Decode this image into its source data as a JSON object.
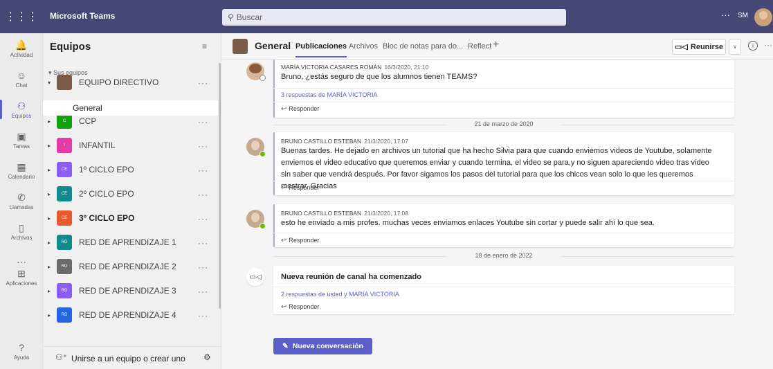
{
  "titlebar": {
    "app_name": "Microsoft Teams",
    "search_placeholder": "Buscar",
    "more": "···",
    "user_initials": "SM"
  },
  "rail": {
    "items": [
      {
        "label": "Actividad",
        "icon": "bell-icon",
        "glyph": "🔔"
      },
      {
        "label": "Chat",
        "icon": "chat-icon",
        "glyph": "☺"
      },
      {
        "label": "Equipos",
        "icon": "teams-icon",
        "glyph": "⚇"
      },
      {
        "label": "Tareas",
        "icon": "assignments-icon",
        "glyph": "▣"
      },
      {
        "label": "Calendario",
        "icon": "calendar-icon",
        "glyph": "▦"
      },
      {
        "label": "Llamadas",
        "icon": "phone-icon",
        "glyph": "✆"
      },
      {
        "label": "Archivos",
        "icon": "file-icon",
        "glyph": "▯"
      },
      {
        "label": "",
        "icon": "more-apps-icon",
        "glyph": "···"
      },
      {
        "label": "Aplicaciones",
        "icon": "apps-icon",
        "glyph": "⊞"
      },
      {
        "label": "Ayuda",
        "icon": "help-icon",
        "glyph": "?"
      }
    ],
    "active_index": 2
  },
  "teams_panel": {
    "title": "Equipos",
    "section_label": "Sus equipos",
    "selected_channel": "General",
    "teams": [
      {
        "name": "EQUIPO DIRECTIVO",
        "tile": "",
        "color": "#7a5c48",
        "bold": false,
        "expanded": true
      },
      {
        "name": "CCP",
        "tile": "C",
        "color": "#13a10e",
        "bold": false
      },
      {
        "name": "INFANTIL",
        "tile": "I",
        "color": "#e43ba6",
        "bold": false
      },
      {
        "name": "1º CICLO EPO",
        "tile": "CE",
        "color": "#8b5cf6",
        "bold": false
      },
      {
        "name": "2º CICLO EPO",
        "tile": "CE",
        "color": "#0f8b8d",
        "bold": false
      },
      {
        "name": "3º CICLO EPO",
        "tile": "CE",
        "color": "#e8592b",
        "bold": true
      },
      {
        "name": "RED DE APRENDIZAJE 1",
        "tile": "RD",
        "color": "#0f8b8d",
        "bold": false
      },
      {
        "name": "RED DE APRENDIZAJE 2",
        "tile": "RD",
        "color": "#6b6b6b",
        "bold": false
      },
      {
        "name": "RED DE APRENDIZAJE 3",
        "tile": "RD",
        "color": "#8b5cf6",
        "bold": false
      },
      {
        "name": "RED DE APRENDIZAJE 4",
        "tile": "RD",
        "color": "#2266e3",
        "bold": false
      }
    ],
    "footer_label": "Unirse a un equipo o crear uno"
  },
  "channel_header": {
    "name": "General",
    "tabs": [
      "Publicaciones",
      "Archivos",
      "Bloc de notas para do...",
      "Reflect"
    ],
    "meet_label": "Reunirse"
  },
  "feed": {
    "messages": [
      {
        "author": "MARÍA VICTORIA CASARES ROMÁN",
        "timestamp": "16/3/2020, 21:10",
        "text": "Bruno, ¿estás seguro de que los alumnos tienen TEAMS?",
        "replies_label": "3 respuestas de MARÍA VICTORIA",
        "reply_label": "Responder"
      },
      {
        "author": "BRUNO CASTILLO ESTEBAN",
        "timestamp": "21/3/2020, 17:07",
        "text": "Buenas tardes. He dejado en archivos un tutorial que ha hecho Silvia para que cuando enviemos videos de Youtube, solamente enviemos el video educativo que queremos enviar y cuando termina, el video se para,y no siguen apareciendo video tras video sin saber que vendrá después. Por favor sigamos los pasos del tutorial para que los chicos vean solo lo que les queremos mostrar. Gracias",
        "reply_label": "Responder"
      },
      {
        "author": "BRUNO CASTILLO ESTEBAN",
        "timestamp": "21/3/2020, 17:08",
        "text": "esto he enviado a mis profes. muchas veces enviamos enlaces Youtube sin cortar y puede salir ahí lo que sea.",
        "reply_label": "Responder"
      },
      {
        "title": "Nueva reunión de canal ha comenzado",
        "replies_label": "2 respuestas de usted y MARÍA VICTORIA",
        "reply_label": "Responder"
      }
    ],
    "date_separators": [
      "21 de marzo de 2020",
      "18 de enero de 2022"
    ],
    "new_conversation_label": "Nueva conversación"
  },
  "colors": {
    "titlebar": "#464775",
    "accent": "#5b5fc7",
    "presence_available": "#6bb700"
  }
}
